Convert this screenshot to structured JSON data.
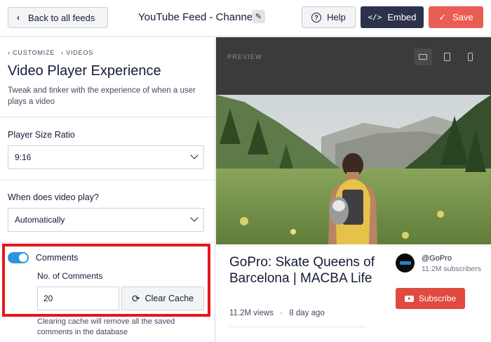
{
  "header": {
    "back_label": "Back to all feeds",
    "feed_title": "YouTube Feed - Channel",
    "help_label": "Help",
    "embed_label": "Embed",
    "save_label": "Save"
  },
  "sidebar": {
    "breadcrumb": [
      "Customize",
      "Videos"
    ],
    "title": "Video Player Experience",
    "description": "Tweak and tinker with the experience of when a user plays a video",
    "player_size": {
      "label": "Player Size Ratio",
      "value": "9:16"
    },
    "video_play": {
      "label": "When does video play?",
      "value": "Automatically"
    },
    "comments": {
      "label": "Comments",
      "enabled": true,
      "count_label": "No. of Comments",
      "count_value": "20",
      "clear_cache_label": "Clear Cache",
      "note": "Clearing cache will remove all the saved comments in the database"
    }
  },
  "preview": {
    "label": "Preview",
    "devices": [
      "desktop-icon",
      "tablet-icon",
      "phone-icon"
    ],
    "active_device": "desktop",
    "video": {
      "title": "GoPro: Skate Queens of Barcelona | MACBA Life",
      "views": "11.2M views",
      "separator": "·",
      "age": "8 day ago"
    },
    "channel": {
      "name": "@GoPro",
      "subscribers": "11.2M subscribers",
      "subscribe_label": "Subscribe"
    }
  },
  "colors": {
    "accent": "#2c96dc",
    "save": "#ea5d55",
    "embed": "#2c324c",
    "highlight": "#e8151b",
    "subscribe": "#e04a3f"
  }
}
